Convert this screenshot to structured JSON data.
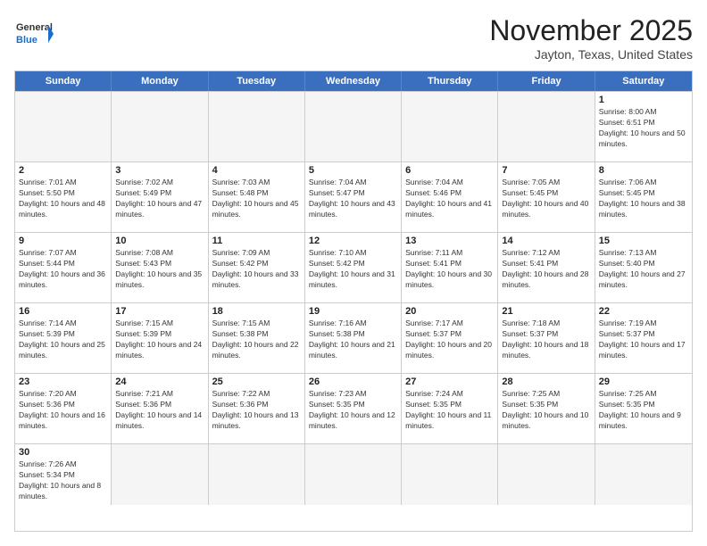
{
  "logo": {
    "text_general": "General",
    "text_blue": "Blue"
  },
  "title": "November 2025",
  "location": "Jayton, Texas, United States",
  "days_of_week": [
    "Sunday",
    "Monday",
    "Tuesday",
    "Wednesday",
    "Thursday",
    "Friday",
    "Saturday"
  ],
  "weeks": [
    [
      {
        "day": "",
        "info": ""
      },
      {
        "day": "",
        "info": ""
      },
      {
        "day": "",
        "info": ""
      },
      {
        "day": "",
        "info": ""
      },
      {
        "day": "",
        "info": ""
      },
      {
        "day": "",
        "info": ""
      },
      {
        "day": "1",
        "info": "Sunrise: 8:00 AM\nSunset: 6:51 PM\nDaylight: 10 hours and 50 minutes."
      }
    ],
    [
      {
        "day": "2",
        "info": "Sunrise: 7:01 AM\nSunset: 5:50 PM\nDaylight: 10 hours and 48 minutes."
      },
      {
        "day": "3",
        "info": "Sunrise: 7:02 AM\nSunset: 5:49 PM\nDaylight: 10 hours and 47 minutes."
      },
      {
        "day": "4",
        "info": "Sunrise: 7:03 AM\nSunset: 5:48 PM\nDaylight: 10 hours and 45 minutes."
      },
      {
        "day": "5",
        "info": "Sunrise: 7:04 AM\nSunset: 5:47 PM\nDaylight: 10 hours and 43 minutes."
      },
      {
        "day": "6",
        "info": "Sunrise: 7:04 AM\nSunset: 5:46 PM\nDaylight: 10 hours and 41 minutes."
      },
      {
        "day": "7",
        "info": "Sunrise: 7:05 AM\nSunset: 5:45 PM\nDaylight: 10 hours and 40 minutes."
      },
      {
        "day": "8",
        "info": "Sunrise: 7:06 AM\nSunset: 5:45 PM\nDaylight: 10 hours and 38 minutes."
      }
    ],
    [
      {
        "day": "9",
        "info": "Sunrise: 7:07 AM\nSunset: 5:44 PM\nDaylight: 10 hours and 36 minutes."
      },
      {
        "day": "10",
        "info": "Sunrise: 7:08 AM\nSunset: 5:43 PM\nDaylight: 10 hours and 35 minutes."
      },
      {
        "day": "11",
        "info": "Sunrise: 7:09 AM\nSunset: 5:42 PM\nDaylight: 10 hours and 33 minutes."
      },
      {
        "day": "12",
        "info": "Sunrise: 7:10 AM\nSunset: 5:42 PM\nDaylight: 10 hours and 31 minutes."
      },
      {
        "day": "13",
        "info": "Sunrise: 7:11 AM\nSunset: 5:41 PM\nDaylight: 10 hours and 30 minutes."
      },
      {
        "day": "14",
        "info": "Sunrise: 7:12 AM\nSunset: 5:41 PM\nDaylight: 10 hours and 28 minutes."
      },
      {
        "day": "15",
        "info": "Sunrise: 7:13 AM\nSunset: 5:40 PM\nDaylight: 10 hours and 27 minutes."
      }
    ],
    [
      {
        "day": "16",
        "info": "Sunrise: 7:14 AM\nSunset: 5:39 PM\nDaylight: 10 hours and 25 minutes."
      },
      {
        "day": "17",
        "info": "Sunrise: 7:15 AM\nSunset: 5:39 PM\nDaylight: 10 hours and 24 minutes."
      },
      {
        "day": "18",
        "info": "Sunrise: 7:15 AM\nSunset: 5:38 PM\nDaylight: 10 hours and 22 minutes."
      },
      {
        "day": "19",
        "info": "Sunrise: 7:16 AM\nSunset: 5:38 PM\nDaylight: 10 hours and 21 minutes."
      },
      {
        "day": "20",
        "info": "Sunrise: 7:17 AM\nSunset: 5:37 PM\nDaylight: 10 hours and 20 minutes."
      },
      {
        "day": "21",
        "info": "Sunrise: 7:18 AM\nSunset: 5:37 PM\nDaylight: 10 hours and 18 minutes."
      },
      {
        "day": "22",
        "info": "Sunrise: 7:19 AM\nSunset: 5:37 PM\nDaylight: 10 hours and 17 minutes."
      }
    ],
    [
      {
        "day": "23",
        "info": "Sunrise: 7:20 AM\nSunset: 5:36 PM\nDaylight: 10 hours and 16 minutes."
      },
      {
        "day": "24",
        "info": "Sunrise: 7:21 AM\nSunset: 5:36 PM\nDaylight: 10 hours and 14 minutes."
      },
      {
        "day": "25",
        "info": "Sunrise: 7:22 AM\nSunset: 5:36 PM\nDaylight: 10 hours and 13 minutes."
      },
      {
        "day": "26",
        "info": "Sunrise: 7:23 AM\nSunset: 5:35 PM\nDaylight: 10 hours and 12 minutes."
      },
      {
        "day": "27",
        "info": "Sunrise: 7:24 AM\nSunset: 5:35 PM\nDaylight: 10 hours and 11 minutes."
      },
      {
        "day": "28",
        "info": "Sunrise: 7:25 AM\nSunset: 5:35 PM\nDaylight: 10 hours and 10 minutes."
      },
      {
        "day": "29",
        "info": "Sunrise: 7:25 AM\nSunset: 5:35 PM\nDaylight: 10 hours and 9 minutes."
      }
    ],
    [
      {
        "day": "30",
        "info": "Sunrise: 7:26 AM\nSunset: 5:34 PM\nDaylight: 10 hours and 8 minutes."
      },
      {
        "day": "",
        "info": ""
      },
      {
        "day": "",
        "info": ""
      },
      {
        "day": "",
        "info": ""
      },
      {
        "day": "",
        "info": ""
      },
      {
        "day": "",
        "info": ""
      },
      {
        "day": "",
        "info": ""
      }
    ]
  ]
}
